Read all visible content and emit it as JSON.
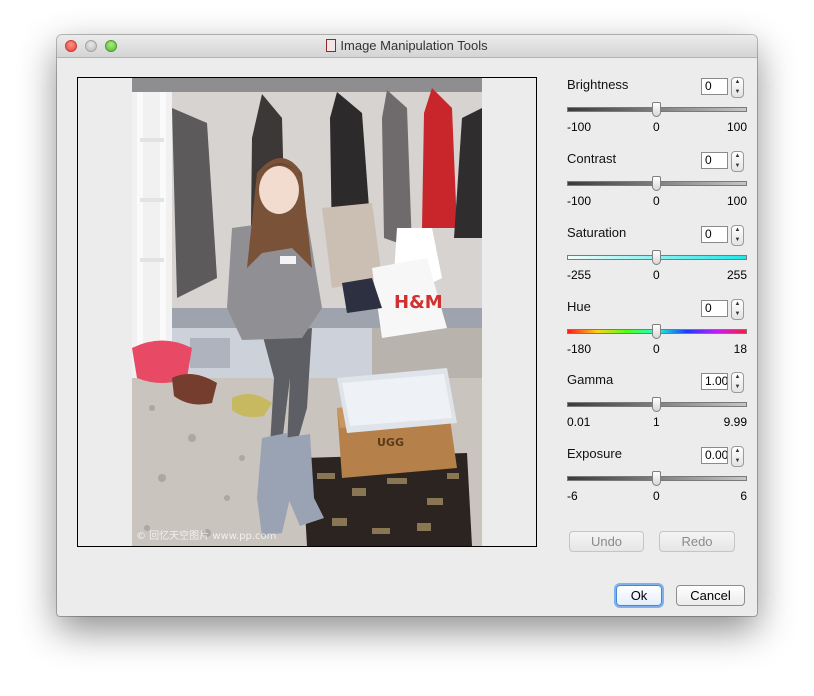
{
  "window": {
    "title": "Image Manipulation Tools"
  },
  "image": {
    "watermark": "© 回忆天空图片  www.pp.com"
  },
  "controls": [
    {
      "label": "Brightness",
      "value": "0",
      "min": "-100",
      "mid": "0",
      "max": "100",
      "track": "gray"
    },
    {
      "label": "Contrast",
      "value": "0",
      "min": "-100",
      "mid": "0",
      "max": "100",
      "track": "gray"
    },
    {
      "label": "Saturation",
      "value": "0",
      "min": "-255",
      "mid": "0",
      "max": "255",
      "track": "cyan"
    },
    {
      "label": "Hue",
      "value": "0",
      "min": "-180",
      "mid": "0",
      "max": "18",
      "track": "rainbow"
    },
    {
      "label": "Gamma",
      "value": "1.00",
      "min": "0.01",
      "mid": "1",
      "max": "9.99",
      "track": "gray"
    },
    {
      "label": "Exposure",
      "value": "0.00",
      "min": "-6",
      "mid": "0",
      "max": "6",
      "track": "gray"
    }
  ],
  "buttons": {
    "undo": "Undo",
    "redo": "Redo",
    "ok": "Ok",
    "cancel": "Cancel"
  },
  "colors": {
    "window_bg": "#ececec",
    "default_button": "#7fb1ee",
    "close": "#e2463b",
    "minimize": "#b9b9b9",
    "maximize": "#56b83a"
  }
}
